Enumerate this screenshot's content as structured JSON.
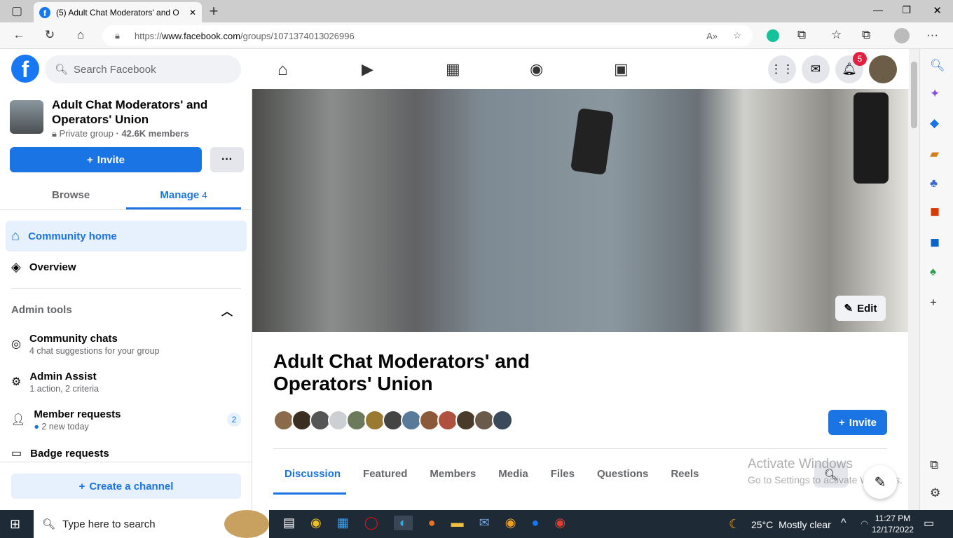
{
  "browser": {
    "tab_title": "(5) Adult Chat Moderators' and O",
    "url_prefix": "https://",
    "url_domain": "www.facebook.com",
    "url_path": "/groups/1071374013026996"
  },
  "header": {
    "search_placeholder": "Search Facebook",
    "notification_count": "5"
  },
  "sidebar": {
    "group_name": "Adult Chat Moderators' and Operators' Union",
    "privacy": "Private group",
    "members": "· 42.6K members",
    "invite": "Invite",
    "more": "···",
    "tab_browse": "Browse",
    "tab_manage": "Manage",
    "manage_count": "4",
    "community_home": "Community home",
    "overview": "Overview",
    "admin_tools": "Admin tools",
    "tools": [
      {
        "title": "Community chats",
        "sub": "4 chat suggestions for your group"
      },
      {
        "title": "Admin Assist",
        "sub": "1 action, 2 criteria"
      },
      {
        "title": "Member requests",
        "sub": "2 new today",
        "badge": "2"
      },
      {
        "title": "Badge requests",
        "sub": ""
      }
    ],
    "create_channel": "Create a channel"
  },
  "main": {
    "edit": "Edit",
    "group_title": "Adult Chat Moderators' and Operators' Union",
    "invite": "Invite",
    "tabs": [
      "Discussion",
      "Featured",
      "Members",
      "Media",
      "Files",
      "Questions",
      "Reels"
    ]
  },
  "watermark": {
    "line1": "Activate Windows",
    "line2": "Go to Settings to activate Windows."
  },
  "taskbar": {
    "search": "Type here to search",
    "temp": "25°C",
    "weather": "Mostly clear",
    "time": "11:27 PM",
    "date": "12/17/2022"
  },
  "colors": {
    "accent": "#1b74e4",
    "taskbar": "#1f2a37"
  }
}
